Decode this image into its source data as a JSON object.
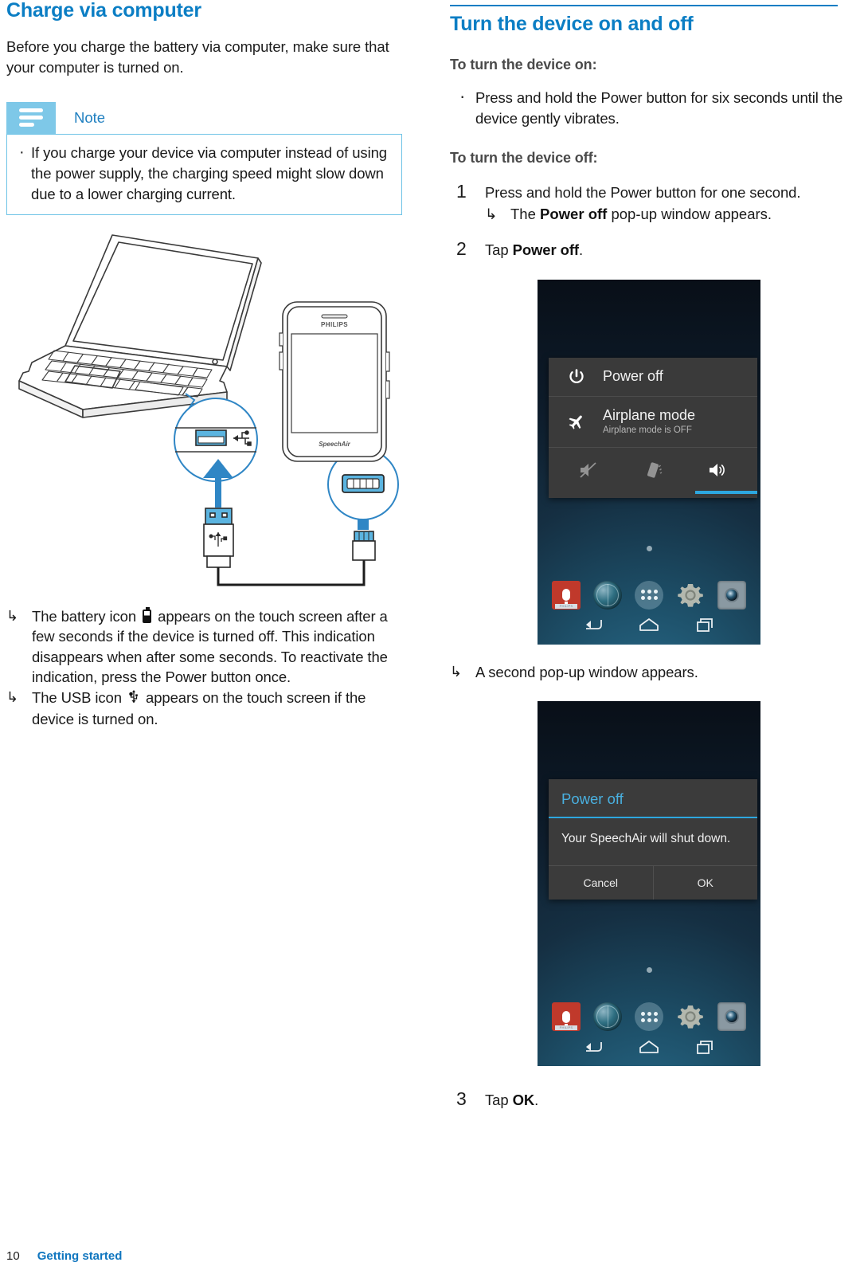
{
  "page": {
    "number": "10",
    "chapter": "Getting started"
  },
  "left": {
    "title": "Charge via computer",
    "intro": "Before you charge the battery via computer, make sure that your computer is turned on.",
    "note": {
      "label": "Note",
      "icon": "note-lines-icon",
      "items": [
        "If you charge your device via computer instead of using the power supply, the charging speed might slow down due to a lower charging current."
      ]
    },
    "illustration": {
      "name": "laptop-usb-connection-diagram",
      "laptop_label": "laptop",
      "device_brand": "PHILIPS",
      "device_model": "SpeechAir",
      "usb_a_callout": "usb-a-port",
      "usb_micro_callout": "micro-usb-port"
    },
    "results": [
      {
        "before": "The battery icon",
        "icon": "battery-icon",
        "after": "appears on the touch screen after a few seconds if the device is turned off. This indication disappears when after some seconds. To reactivate the indication, press the Power button once."
      },
      {
        "before": "The USB icon",
        "icon": "usb-icon",
        "after": "appears on the touch screen if the device is turned on."
      }
    ]
  },
  "right": {
    "title": "Turn the device on and off",
    "subhead_on": "To turn the device on:",
    "bullets_on": [
      "Press and hold the Power button for six seconds until the device gently vibrates."
    ],
    "subhead_off": "To turn the device off:",
    "steps": [
      {
        "num": "1",
        "text": "Press and hold the Power button for one second.",
        "result_prefix": "The ",
        "result_bold": "Power off",
        "result_suffix": " pop-up window appears."
      },
      {
        "num": "2",
        "text_prefix": "Tap ",
        "text_bold": "Power off",
        "text_suffix": "."
      },
      {
        "num": "3",
        "text_prefix": "Tap ",
        "text_bold": "OK",
        "text_suffix": "."
      }
    ],
    "result_second_popup": "A second pop-up window appears.",
    "screenshot_power_menu": {
      "name": "android-power-menu-screenshot",
      "items": [
        {
          "label": "Power off",
          "sublabel": "",
          "icon": "power-icon"
        },
        {
          "label": "Airplane mode",
          "sublabel": "Airplane mode is OFF",
          "icon": "airplane-icon"
        }
      ],
      "sound_modes": [
        {
          "name": "mute-icon",
          "active": false
        },
        {
          "name": "vibrate-icon",
          "active": false
        },
        {
          "name": "sound-on-icon",
          "active": true
        }
      ],
      "dock_apps": [
        "voice-recorder-icon",
        "browser-globe-icon",
        "app-drawer-icon",
        "settings-gear-icon",
        "camera-icon"
      ],
      "nav_buttons": [
        "back-icon",
        "home-icon",
        "recents-icon"
      ]
    },
    "screenshot_confirm": {
      "name": "android-power-off-confirm-screenshot",
      "title": "Power off",
      "message": "Your SpeechAir will shut down.",
      "buttons": [
        "Cancel",
        "OK"
      ],
      "dock_apps": [
        "voice-recorder-icon",
        "browser-globe-icon",
        "app-drawer-icon",
        "settings-gear-icon",
        "camera-icon"
      ],
      "nav_buttons": [
        "back-icon",
        "home-icon",
        "recents-icon"
      ]
    }
  },
  "colors": {
    "heading_blue": "#0b7ec4",
    "note_icon_blue": "#7ec8e8",
    "note_border_blue": "#6ec3e6",
    "accent_blue": "#2da7e0",
    "illustration_blue": "#2f86c5"
  }
}
